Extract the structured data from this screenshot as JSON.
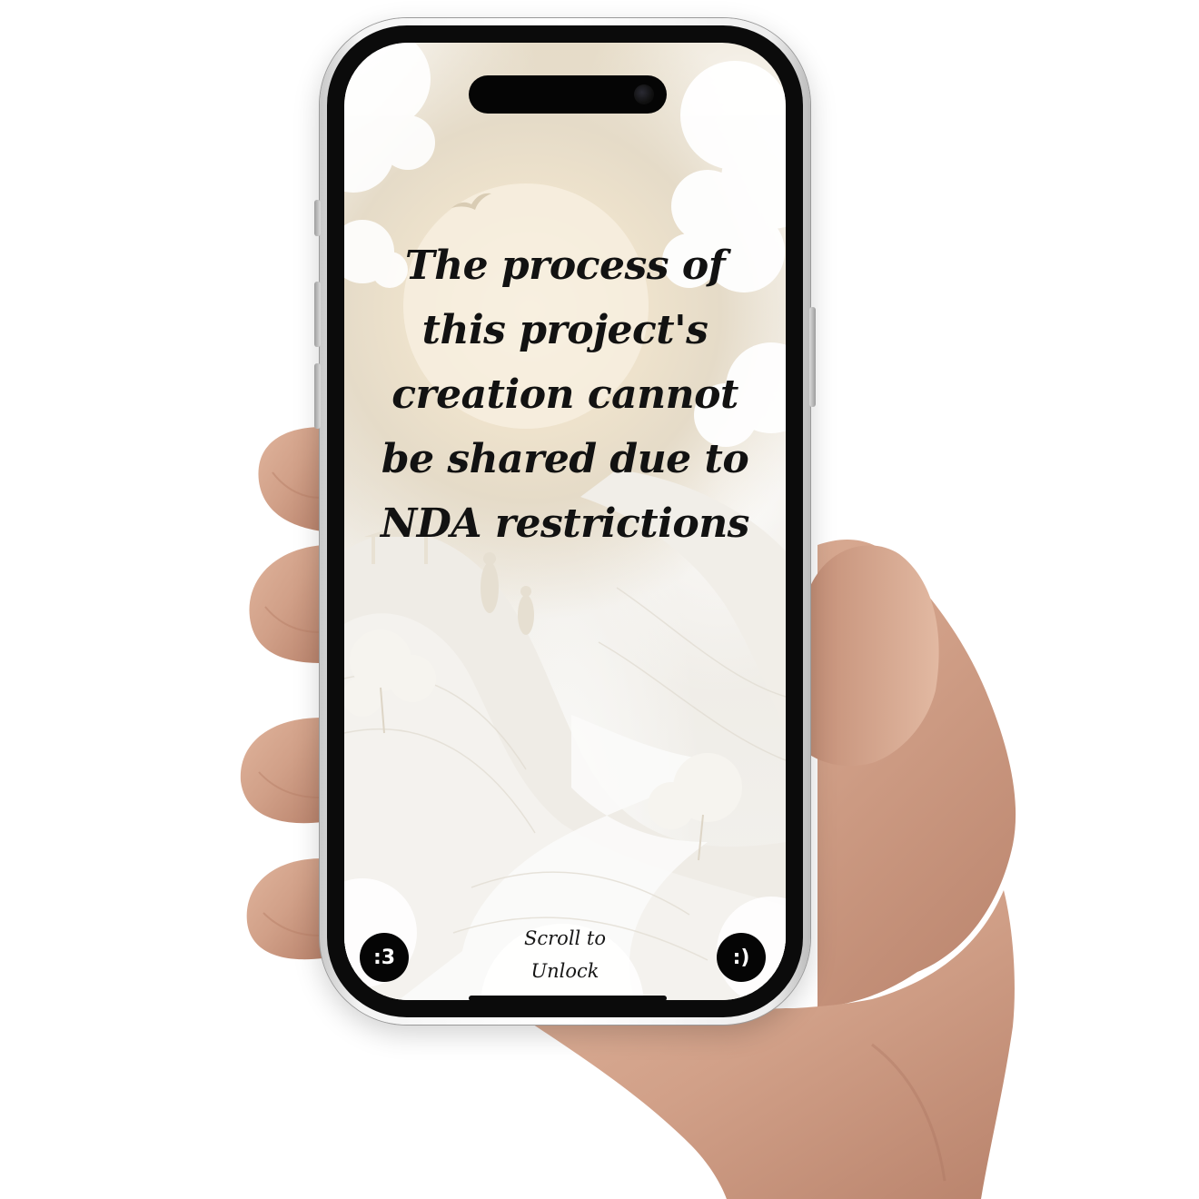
{
  "screen": {
    "message": "The process of this project's creation cannot be shared due to NDA restrictions",
    "left_button_label": ":3",
    "right_button_label": ":)",
    "scroll_hint": {
      "line1": "Scroll to",
      "line2": "Unlock"
    }
  },
  "device": {
    "type": "smartphone",
    "frame_color": "#e9e9e9",
    "screen_text_color": "#121212",
    "button_color": "#050505"
  },
  "icons": {
    "camera": "camera-icon"
  }
}
